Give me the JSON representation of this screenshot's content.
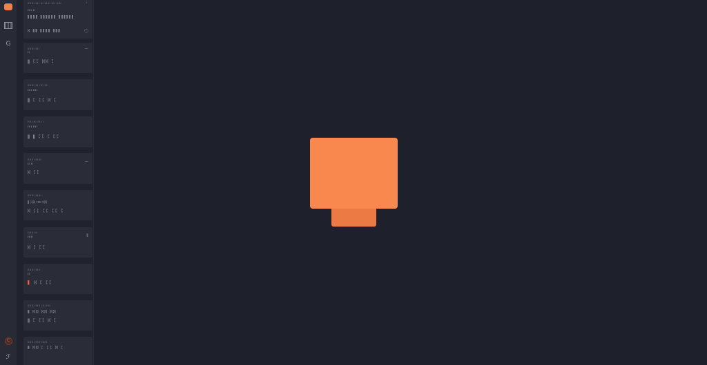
{
  "rail": {
    "icons": [
      "app-logo-icon",
      "grid-icon",
      "g-icon",
      "avatar-icon",
      "f-icon"
    ],
    "g_glyph": "G",
    "avatar_glyph": "C",
    "f_glyph": "ℱ"
  },
  "cards": [
    {
      "title": "ııııııı ıııı ııı ıııııı ıııı ııııı",
      "sub": "ıııı ıı",
      "values": "ǁǁǁǁ ǁǁǁǁǁǁ ǁǁǁǁǁǁ",
      "footer": "ᛞ ǁǁ ǁǁǁǁ ǁǁǁ",
      "action": "⋮",
      "footer_action": "◯"
    },
    {
      "title": "ııııııı ıııı",
      "sub": "ıı",
      "values": "ǁ ᛈᛈ ᛞᛞ ᛈ",
      "action": "—"
    },
    {
      "title": "ııııııı ııı ıııı ıııı",
      "sub": "ıııı ıııı",
      "values": "ǁ ᛈ ᛈᛈ ᛞ ᛈ",
      "action": ""
    },
    {
      "title": "ıııı ıııı ııı ıı",
      "sub": "ıııı ıııı",
      "values": "ǁ ǁ ᛈᛈ ᛈ ᛈᛈ",
      "action": ""
    },
    {
      "title": "ıııııı ııııııı",
      "sub": "ıı ıı",
      "values": "ᛞ ᛈᛈ",
      "action": "—"
    },
    {
      "title": "ııııııı ıııııı",
      "sub": "ǁ ᛞᛞ ıııı ᛞᛞ",
      "values": "ᛞ ᛈᛈ ᛈᛈ ᛈᛈ ᛈ",
      "action": ""
    },
    {
      "title": "ıııııı ııı",
      "sub": "ııııı",
      "values": "ᛞ ᛈ ᛈᛈ",
      "action": "ǁ"
    },
    {
      "title": "ııııııı ııııı",
      "sub": "ıı",
      "values": "ᛞ ᛈ ᛈᛈ",
      "action": "",
      "warn": true
    },
    {
      "title": "ıııııı ıııııı ııı ııııı",
      "sub": "ǁ ᛞᛞ ᛞᛞ ᛞᛞ",
      "values": "ǁ ᛈ ᛈᛈ ᛞ ᛈ",
      "action": ""
    },
    {
      "title": "ıııııı ıııııı ıııııı",
      "sub": "ǁ ᛞᛞ ᛈ ᛈᛈ ᛞ ᛈ",
      "values": "",
      "action": ""
    }
  ],
  "colors": {
    "accent": "#f9884f",
    "accent_dark": "#ec7a45",
    "background": "#1e212b",
    "card": "#2a2d37"
  }
}
